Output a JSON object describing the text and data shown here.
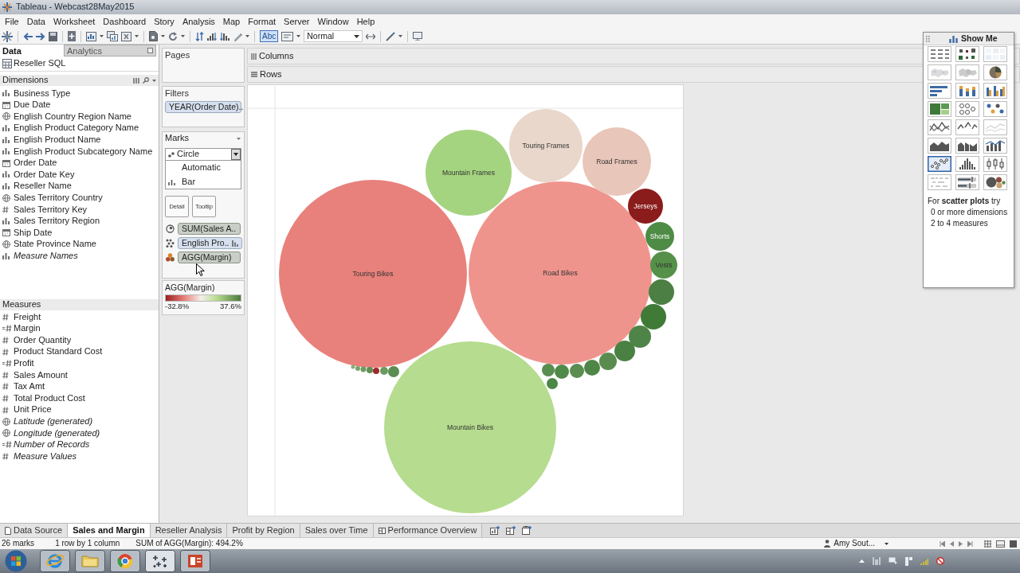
{
  "window": {
    "title": "Tableau - Webcast28May2015"
  },
  "menu": [
    "File",
    "Data",
    "Worksheet",
    "Dashboard",
    "Story",
    "Analysis",
    "Map",
    "Format",
    "Server",
    "Window",
    "Help"
  ],
  "toolbar": {
    "labels_toggle": {
      "label": "Abc",
      "on": true
    },
    "fit": "Normal"
  },
  "data_pane": {
    "tabs": [
      {
        "label": "Data",
        "selected": true
      },
      {
        "label": "Analytics",
        "selected": false
      }
    ],
    "source": "Reseller SQL",
    "dimensions": {
      "title": "Dimensions",
      "fields": [
        {
          "name": "Business Type",
          "kind": "text",
          "generated": false
        },
        {
          "name": "Due Date",
          "kind": "date",
          "generated": false
        },
        {
          "name": "English Country Region Name",
          "kind": "geo",
          "generated": false
        },
        {
          "name": "English Product Category Name",
          "kind": "text",
          "generated": false
        },
        {
          "name": "English Product Name",
          "kind": "text",
          "generated": false
        },
        {
          "name": "English Product Subcategory Name",
          "kind": "text",
          "generated": false
        },
        {
          "name": "Order Date",
          "kind": "date",
          "generated": false
        },
        {
          "name": "Order Date Key",
          "kind": "text",
          "generated": false
        },
        {
          "name": "Reseller Name",
          "kind": "text",
          "generated": false
        },
        {
          "name": "Sales Territory Country",
          "kind": "geo",
          "generated": false
        },
        {
          "name": "Sales Territory Key",
          "kind": "number",
          "generated": false
        },
        {
          "name": "Sales Territory Region",
          "kind": "text",
          "generated": false
        },
        {
          "name": "Ship Date",
          "kind": "date",
          "generated": false
        },
        {
          "name": "State Province Name",
          "kind": "geo",
          "generated": false
        },
        {
          "name": "Measure Names",
          "kind": "text",
          "generated": true
        }
      ]
    },
    "measures": {
      "title": "Measures",
      "fields": [
        {
          "name": "Freight",
          "kind": "number",
          "generated": false
        },
        {
          "name": "Margin",
          "kind": "calc",
          "generated": false
        },
        {
          "name": "Order Quantity",
          "kind": "number",
          "generated": false
        },
        {
          "name": "Product Standard Cost",
          "kind": "number",
          "generated": false
        },
        {
          "name": "Profit",
          "kind": "calc",
          "generated": false
        },
        {
          "name": "Sales Amount",
          "kind": "number",
          "generated": false
        },
        {
          "name": "Tax Amt",
          "kind": "number",
          "generated": false
        },
        {
          "name": "Total Product Cost",
          "kind": "number",
          "generated": false
        },
        {
          "name": "Unit Price",
          "kind": "number",
          "generated": false
        },
        {
          "name": "Latitude (generated)",
          "kind": "geo",
          "generated": true
        },
        {
          "name": "Longitude (generated)",
          "kind": "geo",
          "generated": true
        },
        {
          "name": "Number of Records",
          "kind": "calc",
          "generated": true
        },
        {
          "name": "Measure Values",
          "kind": "number",
          "generated": true
        }
      ]
    }
  },
  "cards": {
    "pages": {
      "title": "Pages"
    },
    "filters": {
      "title": "Filters",
      "pills": [
        {
          "label": "YEAR(Order Date).."
        }
      ]
    },
    "marks": {
      "title": "Marks",
      "type": "Circle",
      "options": [
        {
          "label": "Automatic",
          "kind": "auto"
        },
        {
          "label": "Bar",
          "kind": "bar"
        }
      ],
      "buttons": [
        "Detail",
        "Tooltip"
      ],
      "pills": [
        {
          "label": "SUM(Sales A..",
          "kind": "size",
          "discrete": false,
          "sorted": false
        },
        {
          "label": "English Pro..",
          "kind": "detail",
          "discrete": true,
          "sorted": true
        },
        {
          "label": "AGG(Margin)",
          "kind": "color",
          "discrete": false,
          "sorted": false
        }
      ]
    },
    "legend": {
      "title": "AGG(Margin)",
      "min": "-32.8%",
      "max": "37.6%"
    }
  },
  "shelves": {
    "columns": "Columns",
    "rows": "Rows"
  },
  "view": {
    "bubbles": [
      {
        "label": "Touring Bikes",
        "color": "#e8817b"
      },
      {
        "label": "Road Bikes",
        "color": "#ef948d"
      },
      {
        "label": "Mountain Bikes",
        "color": "#b6dc8f"
      },
      {
        "label": "Mountain Frames",
        "color": "#a5d480"
      },
      {
        "label": "Touring Frames",
        "color": "#e8d7ca"
      },
      {
        "label": "Road Frames",
        "color": "#e8c6b9"
      },
      {
        "label": "Jerseys",
        "color": "#8b1c1c"
      },
      {
        "label": "Shorts",
        "color": "#4e8b45"
      },
      {
        "label": "Vests",
        "color": "#559148"
      },
      {
        "color": "#4b7f43"
      },
      {
        "color": "#3f7a37"
      },
      {
        "color": "#4e8447"
      },
      {
        "color": "#4a8142"
      },
      {
        "color": "#5a8c50"
      },
      {
        "color": "#4f8647"
      },
      {
        "color": "#5b8d51"
      },
      {
        "color": "#4f8a48"
      },
      {
        "color": "#5a8d50"
      },
      {
        "color": "#4d8746"
      },
      {
        "color": "#5a8d50"
      },
      {
        "color": "#6a9a5e"
      },
      {
        "color": "#a0282a"
      },
      {
        "color": "#5e9054"
      },
      {
        "color": "#6d9c62"
      },
      {
        "color": "#79a56d"
      },
      {
        "color": "#86ad79"
      }
    ]
  },
  "show_me": {
    "title": "Show Me",
    "charts": [
      {
        "selected": false,
        "disabled": false
      },
      {
        "selected": false,
        "disabled": false
      },
      {
        "selected": false,
        "disabled": true
      },
      {
        "selected": false,
        "disabled": true
      },
      {
        "selected": false,
        "disabled": true
      },
      {
        "selected": false,
        "disabled": false
      },
      {
        "selected": false,
        "disabled": false
      },
      {
        "selected": false,
        "disabled": false
      },
      {
        "selected": false,
        "disabled": false
      },
      {
        "selected": false,
        "disabled": false
      },
      {
        "selected": false,
        "disabled": false
      },
      {
        "selected": false,
        "disabled": false
      },
      {
        "selected": false,
        "disabled": false
      },
      {
        "selected": false,
        "disabled": false
      },
      {
        "selected": false,
        "disabled": true
      },
      {
        "selected": false,
        "disabled": false
      },
      {
        "selected": false,
        "disabled": false
      },
      {
        "selected": false,
        "disabled": false
      },
      {
        "selected": true,
        "disabled": false
      },
      {
        "selected": false,
        "disabled": false
      },
      {
        "selected": false,
        "disabled": false
      },
      {
        "selected": false,
        "disabled": true
      },
      {
        "selected": false,
        "disabled": false
      },
      {
        "selected": false,
        "disabled": false
      }
    ],
    "hint": [
      "For **scatter plots** try",
      "0 or more dimensions",
      "2 to 4 measures"
    ]
  },
  "sheet_tabs": [
    {
      "label": "Data Source",
      "kind": "source",
      "selected": false
    },
    {
      "label": "Sales and Margin",
      "kind": "worksheet",
      "selected": true
    },
    {
      "label": "Reseller Analysis",
      "kind": "worksheet",
      "selected": false
    },
    {
      "label": "Profit by Region",
      "kind": "worksheet",
      "selected": false
    },
    {
      "label": "Sales over Time",
      "kind": "worksheet",
      "selected": false
    },
    {
      "label": "Performance Overview",
      "kind": "dashboard",
      "selected": false
    }
  ],
  "status_bar": {
    "marks": "26 marks",
    "layout": "1 row by 1 column",
    "summary": "SUM of AGG(Margin): 494.2%",
    "user": "Amy Sout..."
  }
}
